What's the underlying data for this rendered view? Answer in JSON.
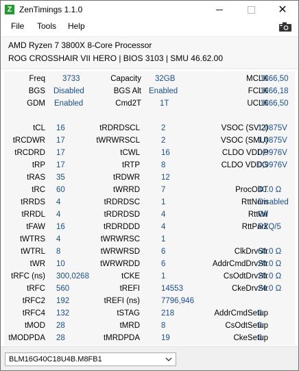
{
  "window": {
    "title": "ZenTimings 1.1.0",
    "icon_letter": "Z"
  },
  "menu": [
    "File",
    "Tools",
    "Help"
  ],
  "header": {
    "cpu": "AMD Ryzen 7 3800X 8-Core Processor",
    "board": "ROG CROSSHAIR VII HERO | BIOS 3103 | SMU 46.62.00"
  },
  "top_rows": [
    [
      [
        "Freq",
        "3733"
      ],
      [
        "Capacity",
        "32GB"
      ],
      [
        "MCLK",
        "1866,50"
      ]
    ],
    [
      [
        "BGS",
        "Disabled"
      ],
      [
        "BGS Alt",
        "Enabled"
      ],
      [
        "FCLK",
        "1866,18"
      ]
    ],
    [
      [
        "GDM",
        "Enabled"
      ],
      [
        "Cmd2T",
        "1T"
      ],
      [
        "UCLK",
        "1866,50"
      ]
    ]
  ],
  "timing_rows": [
    [
      [
        "tCL",
        "16"
      ],
      [
        "tRDRDSCL",
        "2"
      ],
      [
        "VSOC (SVI2)",
        "1,0875V"
      ]
    ],
    [
      [
        "tRCDWR",
        "17"
      ],
      [
        "tWRWRSCL",
        "2"
      ],
      [
        "VSOC (SMU)",
        "1,0875V"
      ]
    ],
    [
      [
        "tRCDRD",
        "17"
      ],
      [
        "tCWL",
        "16"
      ],
      [
        "CLDO VDDP",
        "0,9976V"
      ]
    ],
    [
      [
        "tRP",
        "17"
      ],
      [
        "tRTP",
        "8"
      ],
      [
        "CLDO VDDG",
        "0,9976V"
      ]
    ],
    [
      [
        "tRAS",
        "35"
      ],
      [
        "tRDWR",
        "12"
      ],
      [
        "",
        ""
      ]
    ],
    [
      [
        "tRC",
        "60"
      ],
      [
        "tWRRD",
        "7"
      ],
      [
        "ProcODT",
        "40.0 Ω"
      ]
    ],
    [
      [
        "tRRDS",
        "4"
      ],
      [
        "tRDRDSC",
        "1"
      ],
      [
        "RttNom",
        "Disabled"
      ]
    ],
    [
      [
        "tRRDL",
        "4"
      ],
      [
        "tRDRDSD",
        "4"
      ],
      [
        "RttWr",
        "Off"
      ]
    ],
    [
      [
        "tFAW",
        "16"
      ],
      [
        "tRDRDDD",
        "4"
      ],
      [
        "RttPark",
        "RZQ/5"
      ]
    ],
    [
      [
        "tWTRS",
        "4"
      ],
      [
        "tWRWRSC",
        "1"
      ],
      [
        "",
        ""
      ]
    ],
    [
      [
        "tWTRL",
        "8"
      ],
      [
        "tWRWRSD",
        "6"
      ],
      [
        "ClkDrvStr",
        "60.0 Ω"
      ]
    ],
    [
      [
        "tWR",
        "10"
      ],
      [
        "tWRWRDD",
        "6"
      ],
      [
        "AddrCmdDrvStr",
        "20.0 Ω"
      ]
    ],
    [
      [
        "tRFC (ns)",
        "300,0268"
      ],
      [
        "tCKE",
        "1"
      ],
      [
        "CsOdtDrvStr",
        "20.0 Ω"
      ]
    ],
    [
      [
        "tRFC",
        "560"
      ],
      [
        "tREFI",
        "14553"
      ],
      [
        "CkeDrvStr",
        "24.0 Ω"
      ]
    ],
    [
      [
        "tRFC2",
        "192"
      ],
      [
        "tREFI (ns)",
        "7796,946"
      ],
      [
        "",
        ""
      ]
    ],
    [
      [
        "tRFC4",
        "132"
      ],
      [
        "tSTAG",
        "218"
      ],
      [
        "AddrCmdSetup",
        "0"
      ]
    ],
    [
      [
        "tMOD",
        "28"
      ],
      [
        "tMRD",
        "8"
      ],
      [
        "CsOdtSetup",
        "0"
      ]
    ],
    [
      [
        "tMODPDA",
        "28"
      ],
      [
        "tMRDPDA",
        "19"
      ],
      [
        "CkeSetup",
        "0"
      ]
    ]
  ],
  "module_select": {
    "selected": "BLM16G40C18U4B.M8FB1"
  },
  "icons": {
    "close": "close-icon",
    "minimize": "minimize-icon",
    "maximize": "maximize-icon",
    "screenshot": "camera-icon",
    "dropdown": "chevron-down-icon"
  },
  "colors": {
    "value_text": "#1a4e8a",
    "app_icon": "#1f9e2b"
  }
}
